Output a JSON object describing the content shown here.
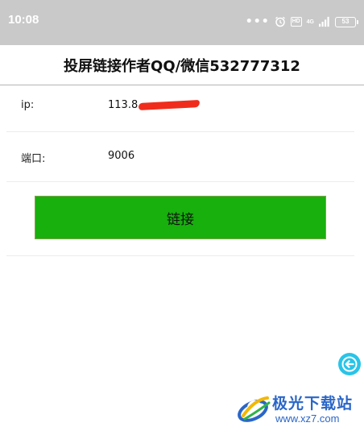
{
  "status_bar": {
    "time": "10:08",
    "dots": "•••",
    "hd_label": "HD",
    "network_label": "4G",
    "battery_level": "53"
  },
  "header": {
    "title": "投屏链接作者QQ/微信532777312"
  },
  "form": {
    "ip_label": "ip:",
    "ip_value": "113.8",
    "port_label": "端口:",
    "port_value": "9006"
  },
  "actions": {
    "connect_label": "链接"
  },
  "watermark": {
    "title": "极光下载站",
    "url": "www.xz7.com"
  },
  "colors": {
    "status_bar": "#c9c9c9",
    "button_green": "#17b00d",
    "fab_blue": "#29c4e8",
    "watermark_blue": "#2a66c8"
  },
  "icons": {
    "fab": "back-arrow-icon",
    "alarm": "alarm-icon",
    "signal": "signal-icon"
  }
}
